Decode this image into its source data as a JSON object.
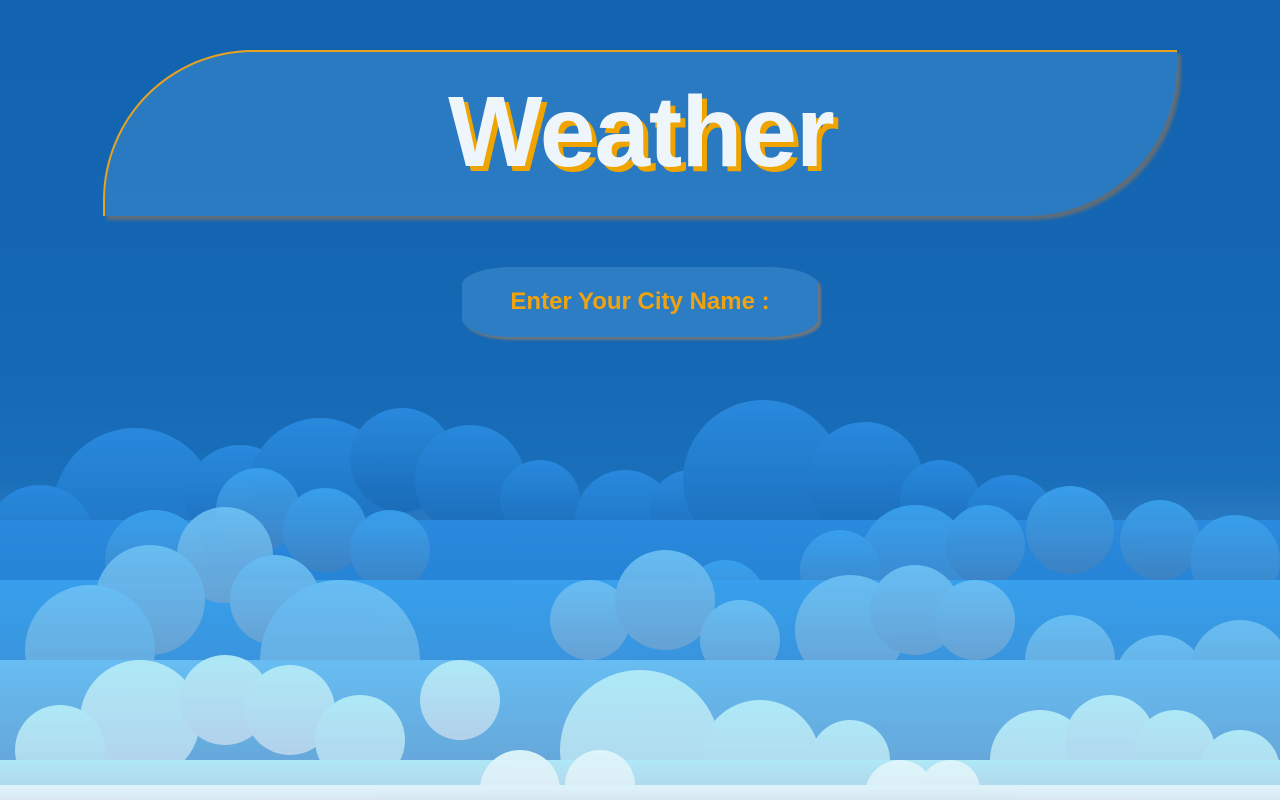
{
  "page": {
    "title": "Weather",
    "city_input": {
      "placeholder": "Enter Your City Name :"
    }
  },
  "colors": {
    "sky_top": "#1263b0",
    "sky_bottom": "#cfe4f3",
    "accent": "#f0a400",
    "title_text": "#eef5fb"
  },
  "icons": {
    "background": "cloud-background"
  }
}
